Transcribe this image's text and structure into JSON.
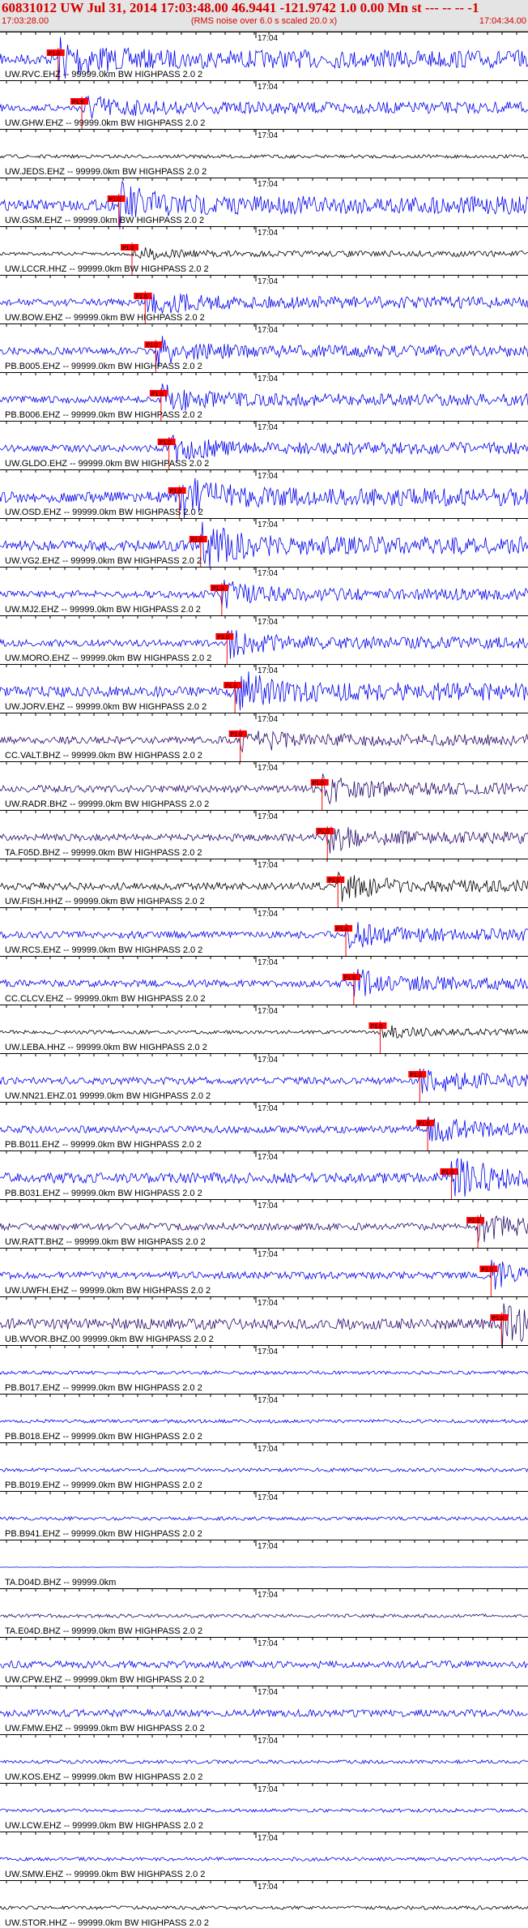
{
  "header": {
    "title": "60831012 UW Jul 31, 2014 17:03:48.00   46.9441 -121.9742  1.0 0.00 Mn st --- -- --  -1",
    "subtitle": "(RMS noise over 6.0 s scaled 20.0 x)",
    "time_start": "17:03:28.00",
    "time_end": "17:04:34.00"
  },
  "center_time_label": "17:04",
  "colors": {
    "header_text": "#d40000",
    "header_bg": "#e4e4e4",
    "trace_blue": "#0000ee",
    "trace_black": "#000000",
    "trace_purple": "#2a0a6a",
    "pick": "#ff0000"
  },
  "channels": [
    {
      "label": "UW.RVC.EHZ -- 99999.0km BW  HIGHPASS  2.0  2",
      "color": "blue",
      "amp": 3,
      "pick_frac": 0.11,
      "pick_label": "P1.0"
    },
    {
      "label": "UW.GHW.EHZ -- 99999.0km BW  HIGHPASS  2.0  2",
      "color": "blue",
      "amp": 2,
      "pick_frac": 0.155,
      "pick_label": "P1.0"
    },
    {
      "label": "UW.JEDS.EHZ -- 99999.0km BW  HIGHPASS  2.0  2",
      "color": "black",
      "amp": 1,
      "pick_frac": null,
      "pick_label": ""
    },
    {
      "label": "UW.GSM.EHZ -- 99999.0km BW  HIGHPASS  2.0  2",
      "color": "blue",
      "amp": 3,
      "pick_frac": 0.225,
      "pick_label": "P1.0"
    },
    {
      "label": "UW.LCCR.HHZ -- 99999.0km BW  HIGHPASS  2.0  2",
      "color": "black",
      "amp": 1,
      "pick_frac": 0.25,
      "pick_label": "P1.0"
    },
    {
      "label": "UW.BOW.EHZ -- 99999.0km BW  HIGHPASS  2.0  2",
      "color": "blue",
      "amp": 2,
      "pick_frac": 0.275,
      "pick_label": "P1.0"
    },
    {
      "label": "PB.B005.EHZ -- 99999.0km BW  HIGHPASS  2.0  2",
      "color": "blue",
      "amp": 2,
      "pick_frac": 0.295,
      "pick_label": "P1.0"
    },
    {
      "label": "PB.B006.EHZ -- 99999.0km BW  HIGHPASS  2.0  2",
      "color": "blue",
      "amp": 2,
      "pick_frac": 0.305,
      "pick_label": "P1.0"
    },
    {
      "label": "UW.GLDO.EHZ -- 99999.0km BW  HIGHPASS  2.0  2",
      "color": "blue",
      "amp": 2,
      "pick_frac": 0.32,
      "pick_label": "P1.0"
    },
    {
      "label": "UW.OSD.EHZ -- 99999.0km BW  HIGHPASS  2.0  2",
      "color": "blue",
      "amp": 3,
      "pick_frac": 0.34,
      "pick_label": "P1.0"
    },
    {
      "label": "UW.VG2.EHZ -- 99999.0km BW  HIGHPASS  2.0  2",
      "color": "blue",
      "amp": 3,
      "pick_frac": 0.38,
      "pick_label": "P1.0"
    },
    {
      "label": "UW.MJ2.EHZ -- 99999.0km BW  HIGHPASS  2.0  2",
      "color": "blue",
      "amp": 2,
      "pick_frac": 0.42,
      "pick_label": "P1.0"
    },
    {
      "label": "UW.MORO.EHZ -- 99999.0km BW  HIGHPASS  2.0  2",
      "color": "blue",
      "amp": 2,
      "pick_frac": 0.43,
      "pick_label": "P1.0"
    },
    {
      "label": "UW.JORV.EHZ -- 99999.0km BW  HIGHPASS  2.0  2",
      "color": "blue",
      "amp": 3,
      "pick_frac": 0.445,
      "pick_label": "P1.0"
    },
    {
      "label": "CC.VALT.BHZ -- 99999.0km BW  HIGHPASS  2.0  2",
      "color": "purple",
      "amp": 2,
      "pick_frac": 0.455,
      "pick_label": "P1.0"
    },
    {
      "label": "UW.RADR.BHZ -- 99999.0km BW  HIGHPASS  2.0  2",
      "color": "purple",
      "amp": 2,
      "pick_frac": 0.61,
      "pick_label": "P1.0"
    },
    {
      "label": "TA.F05D.BHZ -- 99999.0km BW  HIGHPASS  2.0  2",
      "color": "purple",
      "amp": 2,
      "pick_frac": 0.62,
      "pick_label": "P1.0"
    },
    {
      "label": "UW.FISH.HHZ -- 99999.0km BW  HIGHPASS  2.0  2",
      "color": "black",
      "amp": 2,
      "pick_frac": 0.64,
      "pick_label": "P1.0"
    },
    {
      "label": "UW.RCS.EHZ -- 99999.0km BW  HIGHPASS  2.0  2",
      "color": "blue",
      "amp": 2,
      "pick_frac": 0.655,
      "pick_label": "P1.0"
    },
    {
      "label": "CC.CLCV.EHZ -- 99999.0km BW  HIGHPASS  2.0  2",
      "color": "blue",
      "amp": 2,
      "pick_frac": 0.67,
      "pick_label": "P1.0"
    },
    {
      "label": "UW.LEBA.HHZ -- 99999.0km BW  HIGHPASS  2.0  2",
      "color": "black",
      "amp": 1,
      "pick_frac": 0.72,
      "pick_label": "P1.0"
    },
    {
      "label": "UW.NN21.EHZ.01 99999.0km BW  HIGHPASS  2.0  2",
      "color": "blue",
      "amp": 2,
      "pick_frac": 0.795,
      "pick_label": "P1.0"
    },
    {
      "label": "PB.B011.EHZ -- 99999.0km BW  HIGHPASS  2.0  2",
      "color": "blue",
      "amp": 2,
      "pick_frac": 0.81,
      "pick_label": "P1.0"
    },
    {
      "label": "PB.B031.EHZ -- 99999.0km BW  HIGHPASS  2.0  2",
      "color": "blue",
      "amp": 3,
      "pick_frac": 0.855,
      "pick_label": "P1.0"
    },
    {
      "label": "UW.RATT.BHZ -- 99999.0km BW  HIGHPASS  2.0  2",
      "color": "purple",
      "amp": 2,
      "pick_frac": 0.905,
      "pick_label": "P1.0"
    },
    {
      "label": "UW.UWFH.EHZ -- 99999.0km BW  HIGHPASS  2.0  2",
      "color": "blue",
      "amp": 2,
      "pick_frac": 0.93,
      "pick_label": "P1.0"
    },
    {
      "label": "UB.WVOR.BHZ.00 99999.0km BW  HIGHPASS  2.0  2",
      "color": "purple",
      "amp": 3,
      "pick_frac": 0.95,
      "pick_label": "P1.0"
    },
    {
      "label": "PB.B017.EHZ -- 99999.0km BW  HIGHPASS  2.0  2",
      "color": "blue",
      "amp": 1,
      "pick_frac": null,
      "pick_label": ""
    },
    {
      "label": "PB.B018.EHZ -- 99999.0km BW  HIGHPASS  2.0  2",
      "color": "blue",
      "amp": 1,
      "pick_frac": null,
      "pick_label": ""
    },
    {
      "label": "PB.B019.EHZ -- 99999.0km BW  HIGHPASS  2.0  2",
      "color": "blue",
      "amp": 1,
      "pick_frac": null,
      "pick_label": ""
    },
    {
      "label": "PB.B941.EHZ -- 99999.0km BW  HIGHPASS  2.0  2",
      "color": "blue",
      "amp": 1,
      "pick_frac": null,
      "pick_label": ""
    },
    {
      "label": "TA.D04D.BHZ -- 99999.0km",
      "color": "blue",
      "amp": 0,
      "pick_frac": null,
      "pick_label": ""
    },
    {
      "label": "TA.E04D.BHZ -- 99999.0km BW  HIGHPASS  2.0  2",
      "color": "purple",
      "amp": 1,
      "pick_frac": null,
      "pick_label": ""
    },
    {
      "label": "UW.CPW.EHZ -- 99999.0km BW  HIGHPASS  2.0  2",
      "color": "blue",
      "amp": 2,
      "pick_frac": null,
      "pick_label": ""
    },
    {
      "label": "UW.FMW.EHZ -- 99999.0km BW  HIGHPASS  2.0  2",
      "color": "blue",
      "amp": 2,
      "pick_frac": null,
      "pick_label": ""
    },
    {
      "label": "UW.KOS.EHZ -- 99999.0km BW  HIGHPASS  2.0  2",
      "color": "blue",
      "amp": 1,
      "pick_frac": null,
      "pick_label": ""
    },
    {
      "label": "UW.LCW.EHZ -- 99999.0km BW  HIGHPASS  2.0  2",
      "color": "blue",
      "amp": 1,
      "pick_frac": null,
      "pick_label": ""
    },
    {
      "label": "UW.SMW.EHZ -- 99999.0km BW  HIGHPASS  2.0  2",
      "color": "blue",
      "amp": 1,
      "pick_frac": null,
      "pick_label": ""
    },
    {
      "label": "UW.STOR.HHZ -- 99999.0km BW  HIGHPASS  2.0  2",
      "color": "black",
      "amp": 1,
      "pick_frac": null,
      "pick_label": ""
    }
  ]
}
